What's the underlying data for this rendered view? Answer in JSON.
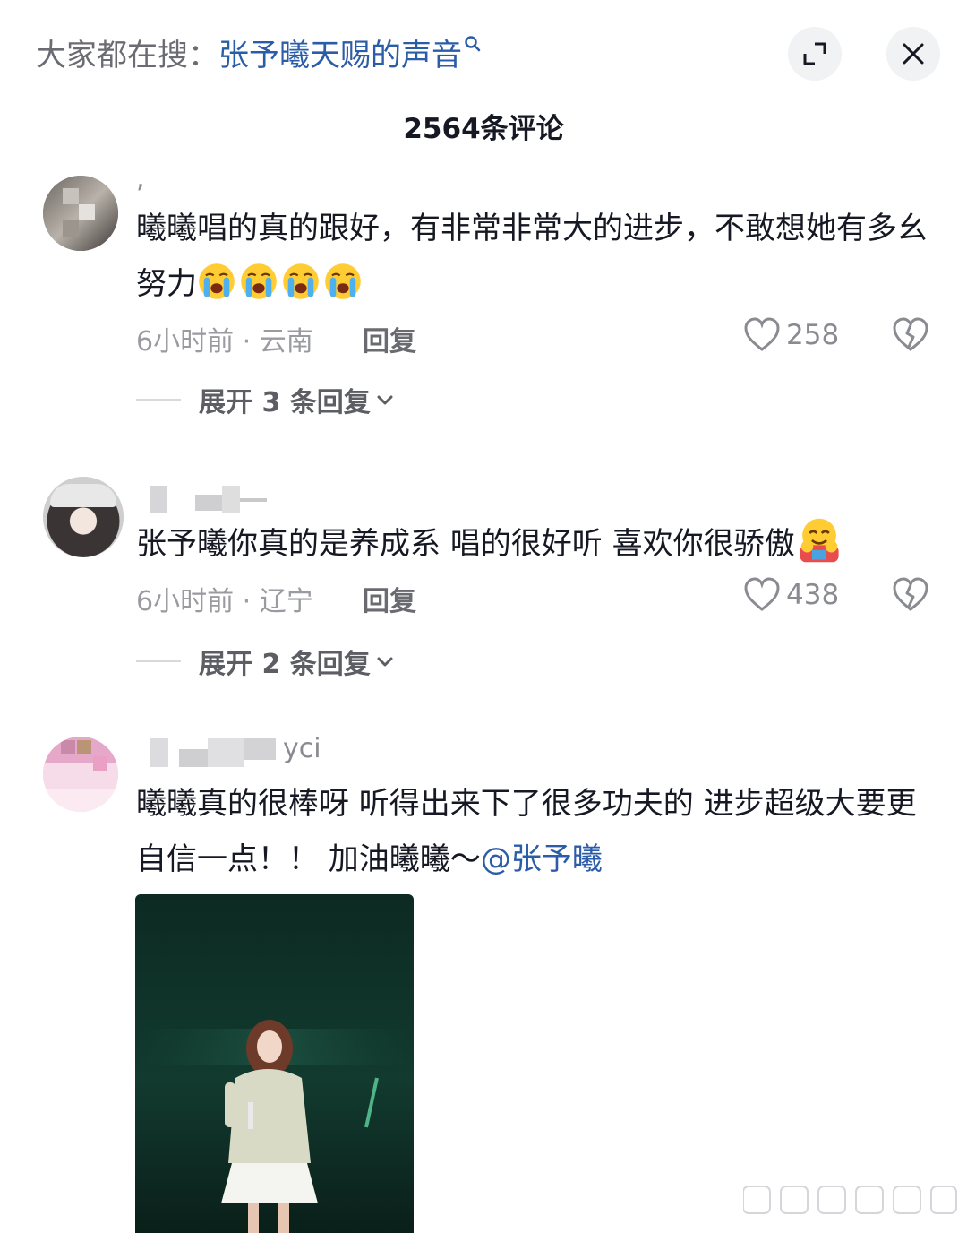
{
  "search_hint": {
    "prefix": "大家都在搜：",
    "query": "张予曦天赐的声音"
  },
  "comment_count": "2564条评论",
  "comments": [
    {
      "username": ",",
      "text": "曦曦唱的真的跟好，有非常非常大的进步，不敢想她有多幺努力",
      "time_location": "6小时前 · 云南",
      "reply_label": "回复",
      "likes": "258",
      "expand_label": "展开 3 条回复",
      "emoji": "loudly-crying-face-icon"
    },
    {
      "username": "",
      "text": "张予曦你真的是养成系 唱的很好听 喜欢你很骄傲",
      "time_location": "6小时前 · 辽宁",
      "reply_label": "回复",
      "likes": "438",
      "expand_label": "展开 2 条回复",
      "emoji": "hugging-face-icon"
    },
    {
      "username": "yci",
      "text": "曦曦真的很棒呀 听得出来下了很多功夫的 进步超级大要更自信一点！！ 加油曦曦～",
      "mention": "@张予曦",
      "image": "concert-photo"
    }
  ],
  "colors": {
    "accent_link": "#2b5ca8",
    "text_primary": "#161823",
    "text_secondary": "#9a9ba0"
  }
}
